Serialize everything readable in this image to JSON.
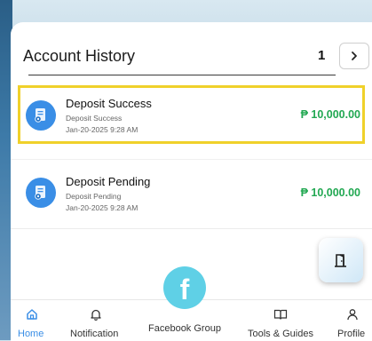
{
  "header": {
    "title": "Account History",
    "page_number": "1",
    "next_icon": "chevron-right-icon"
  },
  "transactions": [
    {
      "title": "Deposit Success",
      "subtitle": "Deposit Success",
      "datetime": "Jan-20-2025 9:28 AM",
      "amount": "₱ 10,000.00",
      "icon": "receipt-icon",
      "highlighted": true
    },
    {
      "title": "Deposit Pending",
      "subtitle": "Deposit Pending",
      "datetime": "Jan-20-2025 9:28 AM",
      "amount": "₱ 10,000.00",
      "icon": "receipt-icon",
      "highlighted": false
    }
  ],
  "floating_button": {
    "icon": "exit-door-icon"
  },
  "nav": {
    "items": [
      {
        "label": "Home",
        "icon": "home-icon",
        "active": true
      },
      {
        "label": "Notification",
        "icon": "bell-icon",
        "active": false
      },
      {
        "label": "Facebook Group",
        "icon": "facebook-icon",
        "active": false
      },
      {
        "label": "Tools & Guides",
        "icon": "book-icon",
        "active": false
      },
      {
        "label": "Profile",
        "icon": "person-icon",
        "active": false
      }
    ]
  },
  "colors": {
    "accent": "#3a8ee6",
    "amount": "#22a852",
    "highlight": "#f0d12a",
    "facebook_bubble": "#5fd0e6"
  }
}
